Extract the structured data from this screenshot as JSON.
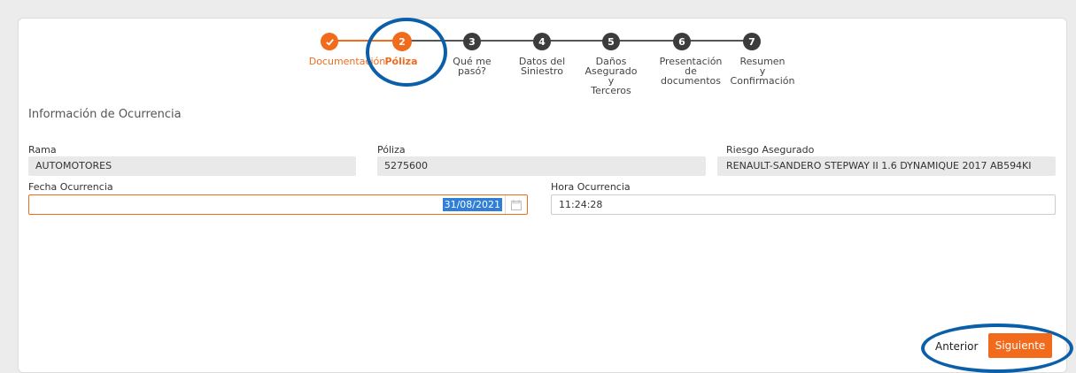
{
  "stepper": {
    "steps": [
      {
        "number": "✓",
        "label": "Documentación",
        "state": "done"
      },
      {
        "number": "2",
        "label": "Póliza",
        "state": "active"
      },
      {
        "number": "3",
        "label": "Qué me\npasó?",
        "state": "pending"
      },
      {
        "number": "4",
        "label": "Datos del\nSiniestro",
        "state": "pending"
      },
      {
        "number": "5",
        "label": "Daños\nAsegurado\ny\nTerceros",
        "state": "pending"
      },
      {
        "number": "6",
        "label": "Presentación\nde\ndocumentos",
        "state": "pending"
      },
      {
        "number": "7",
        "label": "Resumen\ny\nConfirmación",
        "state": "pending"
      }
    ]
  },
  "form": {
    "section_title": "Información de Ocurrencia",
    "rama": {
      "label": "Rama",
      "value": "AUTOMOTORES"
    },
    "poliza": {
      "label": "Póliza",
      "value": "5275600"
    },
    "riesgo": {
      "label": "Riesgo Asegurado",
      "value": "RENAULT-SANDERO STEPWAY II 1.6 DYNAMIQUE 2017 AB594KI"
    },
    "fecha": {
      "label": "Fecha Ocurrencia",
      "value": "31/08/2021"
    },
    "hora": {
      "label": "Hora Ocurrencia",
      "value": "11:24:28"
    }
  },
  "buttons": {
    "prev": "Anterior",
    "next": "Siguiente"
  },
  "colors": {
    "accent": "#f26a1b",
    "annotation": "#0b5fa9",
    "pending": "#3c3c3c"
  }
}
